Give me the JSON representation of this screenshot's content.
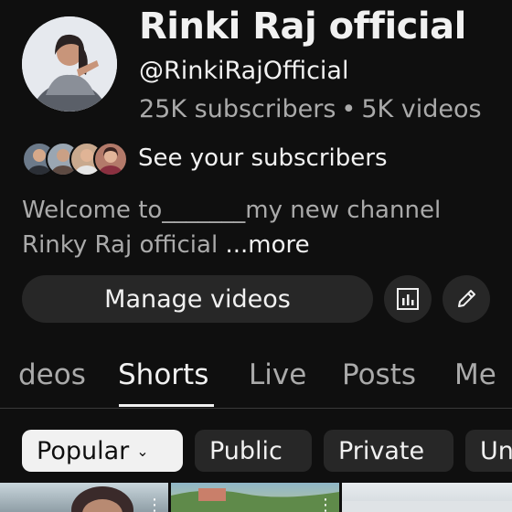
{
  "channel": {
    "name": "Rinki Raj official",
    "handle": "@RinkiRajOfficial",
    "subscribers": "25K subscribers",
    "separator": "•",
    "videos": "5K videos"
  },
  "subscribers_link": {
    "label": "See your subscribers"
  },
  "description": {
    "line1": "Welcome to_______my new channel",
    "line2": "Rinky Raj official ",
    "more": "...more"
  },
  "actions": {
    "manage_videos": "Manage videos",
    "analytics_icon": "analytics-icon",
    "edit_icon": "pencil-icon"
  },
  "tabs": [
    {
      "label": "deos",
      "active": false
    },
    {
      "label": "Shorts",
      "active": true
    },
    {
      "label": "Live",
      "active": false
    },
    {
      "label": "Posts",
      "active": false
    },
    {
      "label": "Me",
      "active": false
    }
  ],
  "filters": [
    {
      "label": "Popular",
      "selected": true,
      "chevron": "⌄"
    },
    {
      "label": "Public",
      "selected": false
    },
    {
      "label": "Private",
      "selected": false
    },
    {
      "label": "Un",
      "selected": false
    }
  ],
  "thumbnail_more_icon": "⋮",
  "colors": {
    "background": "#0f0f0f",
    "text_primary": "#f1f1f1",
    "text_secondary": "#aaaaaa",
    "button_bg": "#272727"
  }
}
